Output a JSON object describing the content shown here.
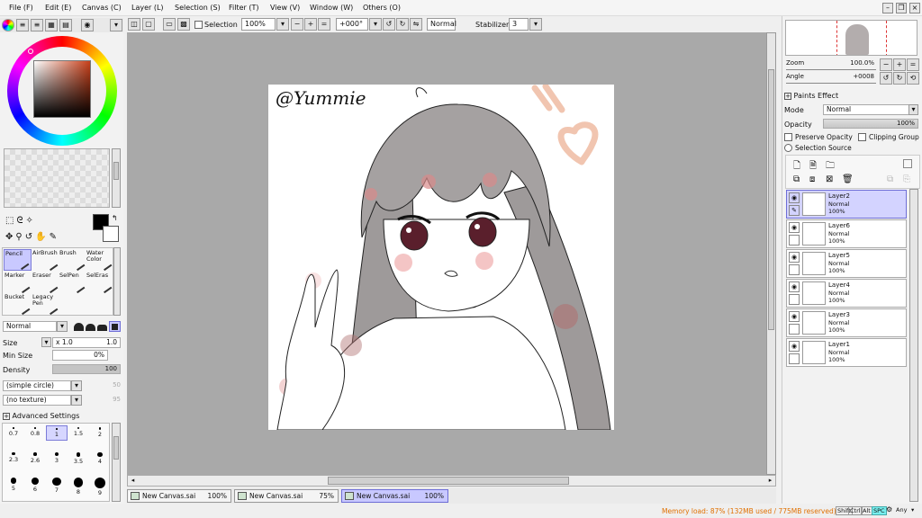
{
  "menu": {
    "file": "File (F)",
    "edit": "Edit (E)",
    "canvas": "Canvas (C)",
    "layer": "Layer (L)",
    "selection": "Selection (S)",
    "filter": "Filter (T)",
    "view": "View (V)",
    "window": "Window (W)",
    "others": "Others (O)"
  },
  "toolbar": {
    "selection_label": "Selection",
    "zoom": "100%",
    "rotation": "+000°",
    "blend": "Normal",
    "stabilizer_label": "Stabilizer",
    "stabilizer_value": "3"
  },
  "tools": {
    "row1": [
      "Pencil",
      "AirBrush",
      "Brush",
      "Water Color"
    ],
    "row2": [
      "Marker",
      "Eraser",
      "SelPen",
      "SelEras"
    ],
    "row3": [
      "Bucket",
      "Legacy Pen"
    ]
  },
  "brush": {
    "mode": "Normal",
    "size_label": "Size",
    "size_mult": "x 1.0",
    "size_value": "1.0",
    "minsize_label": "Min Size",
    "minsize_value": "0%",
    "density_label": "Density",
    "density_value": "100",
    "density_fraction": 1.0,
    "shape": "(simple circle)",
    "shape_value": "50",
    "texture": "(no texture)",
    "texture_value": "95",
    "advanced_label": "Advanced Settings"
  },
  "dots": {
    "row1": [
      "0.7",
      "0.8",
      "1",
      "1.5",
      "2"
    ],
    "row2": [
      "2.3",
      "2.6",
      "3",
      "3.5",
      "4"
    ],
    "row3": [
      "5",
      "6",
      "7",
      "8",
      "9"
    ],
    "selected": "1"
  },
  "canvas": {
    "watermark": "@Yummie"
  },
  "tabs": [
    {
      "name": "New Canvas.sai",
      "zoom": "100%"
    },
    {
      "name": "New Canvas.sai",
      "zoom": "75%"
    },
    {
      "name": "New Canvas.sai",
      "zoom": "100%"
    }
  ],
  "status": {
    "memory": "Memory load: 87% (132MB used / 775MB reserved)",
    "keys": [
      "Shift",
      "Ctrl",
      "Alt",
      "SPC"
    ],
    "any": "Any"
  },
  "navigator": {
    "zoom_label": "Zoom",
    "zoom_value": "100.0%",
    "angle_label": "Angle",
    "angle_value": "+0008"
  },
  "layerprops": {
    "paints_effect": "Paints Effect",
    "mode_label": "Mode",
    "mode_value": "Normal",
    "opacity_label": "Opacity",
    "opacity_value": "100%",
    "preserve_opacity": "Preserve Opacity",
    "clipping_group": "Clipping Group",
    "selection_source": "Selection Source"
  },
  "layers": [
    {
      "name": "Layer2",
      "mode": "Normal",
      "opacity": "100%"
    },
    {
      "name": "Layer6",
      "mode": "Normal",
      "opacity": "100%"
    },
    {
      "name": "Layer5",
      "mode": "Normal",
      "opacity": "100%"
    },
    {
      "name": "Layer4",
      "mode": "Normal",
      "opacity": "100%"
    },
    {
      "name": "Layer3",
      "mode": "Normal",
      "opacity": "100%"
    },
    {
      "name": "Layer1",
      "mode": "Normal",
      "opacity": "100%"
    }
  ],
  "colors": {
    "accent": "#c8c8ff",
    "memory_text": "#e07000"
  }
}
